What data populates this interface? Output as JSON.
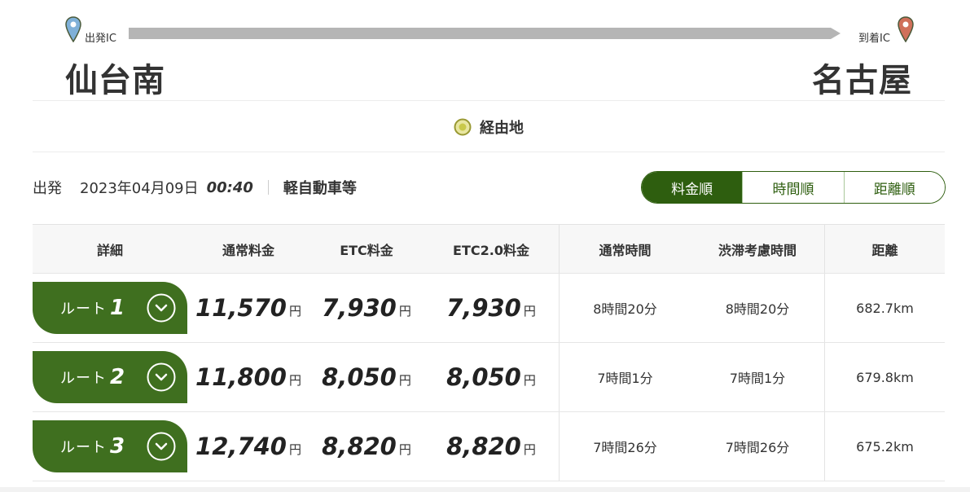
{
  "route": {
    "start_label": "出発IC",
    "end_label": "到着IC",
    "start_name": "仙台南",
    "end_name": "名古屋"
  },
  "waypoint": {
    "label": "経由地"
  },
  "conditions": {
    "departure_label": "出発",
    "date": "2023年04月09日",
    "time": "00:40",
    "vehicle": "軽自動車等"
  },
  "sort": {
    "options": [
      "料金順",
      "時間順",
      "距離順"
    ],
    "active": "料金順"
  },
  "colors": {
    "accent": "#3f6f1f",
    "accent_dark": "#2e5e0f",
    "start_pin": "#7fb0d8",
    "end_pin": "#d0705a",
    "waypoint": "#c9c94a"
  },
  "table": {
    "headers": [
      "詳細",
      "通常料金",
      "ETC料金",
      "ETC2.0料金",
      "通常時間",
      "渋滞考慮時間",
      "距離"
    ],
    "currency": "円",
    "rows": [
      {
        "route_label": "ルート",
        "route_no": "1",
        "normal_fee": "11,570",
        "etc_fee": "7,930",
        "etc2_fee": "7,930",
        "normal_time": "8時間20分",
        "jam_time": "8時間20分",
        "distance": "682.7km"
      },
      {
        "route_label": "ルート",
        "route_no": "2",
        "normal_fee": "11,800",
        "etc_fee": "8,050",
        "etc2_fee": "8,050",
        "normal_time": "7時間1分",
        "jam_time": "7時間1分",
        "distance": "679.8km"
      },
      {
        "route_label": "ルート",
        "route_no": "3",
        "normal_fee": "12,740",
        "etc_fee": "8,820",
        "etc2_fee": "8,820",
        "normal_time": "7時間26分",
        "jam_time": "7時間26分",
        "distance": "675.2km"
      }
    ]
  }
}
